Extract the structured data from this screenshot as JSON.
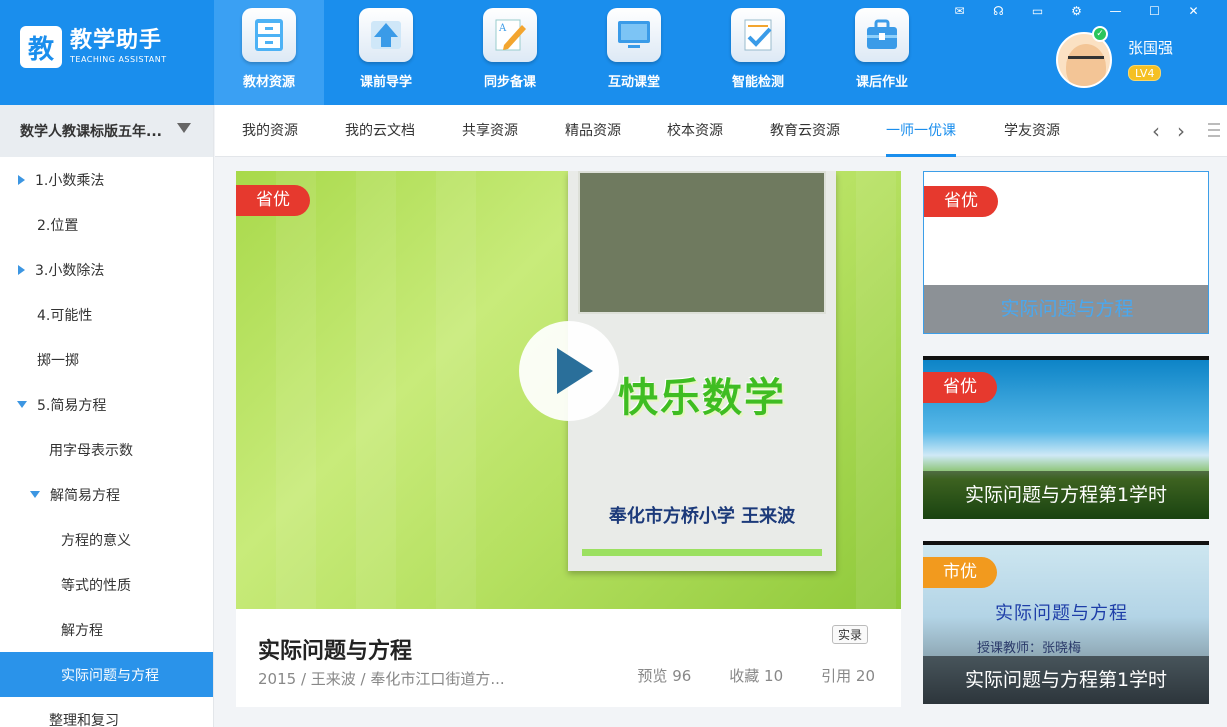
{
  "app": {
    "logo_glyph": "教",
    "name_cn": "教学助手",
    "name_en": "TEACHING ASSISTANT"
  },
  "nav": [
    {
      "label": "教材资源",
      "icon": "cabinet-icon"
    },
    {
      "label": "课前导学",
      "icon": "upload-arrow-icon"
    },
    {
      "label": "同步备课",
      "icon": "pen-paper-icon"
    },
    {
      "label": "互动课堂",
      "icon": "monitor-icon"
    },
    {
      "label": "智能检测",
      "icon": "checklist-icon"
    },
    {
      "label": "课后作业",
      "icon": "toolbox-icon"
    }
  ],
  "window_controls": [
    "mail-icon",
    "headset-icon",
    "chat-icon",
    "gear-icon",
    "minimize-icon",
    "maximize-icon",
    "close-icon"
  ],
  "user": {
    "name": "张国强",
    "level": "LV4"
  },
  "sidebar": {
    "header": "数学人教课标版五年...",
    "items": [
      {
        "label": "1.小数乘法",
        "arrow": "right"
      },
      {
        "label": "2.位置",
        "arrow": ""
      },
      {
        "label": "3.小数除法",
        "arrow": "right"
      },
      {
        "label": "4.可能性",
        "arrow": ""
      },
      {
        "label": "掷一掷",
        "arrow": ""
      },
      {
        "label": "5.简易方程",
        "arrow": "down"
      },
      {
        "label": "用字母表示数",
        "arrow": ""
      },
      {
        "label": "解简易方程",
        "arrow": "down"
      },
      {
        "label": "方程的意义",
        "arrow": ""
      },
      {
        "label": "等式的性质",
        "arrow": ""
      },
      {
        "label": "解方程",
        "arrow": ""
      },
      {
        "label": "实际问题与方程",
        "arrow": ""
      },
      {
        "label": "整理和复习",
        "arrow": ""
      }
    ]
  },
  "tabs": [
    "我的资源",
    "我的云文档",
    "共享资源",
    "精品资源",
    "校本资源",
    "教育云资源",
    "一师一优课",
    "学友资源"
  ],
  "active_tab": "一师一优课",
  "main_video": {
    "tag": "省优",
    "slide_title": "快乐数学",
    "slide_author": "奉化市方桥小学 王来波",
    "title": "实际问题与方程",
    "badge": "实录",
    "meta": "2015 / 王来波 / 奉化市江口街道方...",
    "stats": {
      "preview": "预览 96",
      "favorite": "收藏 10",
      "cite": "引用 20"
    }
  },
  "side_videos": [
    {
      "tag": "省优",
      "caption": "实际问题与方程"
    },
    {
      "tag": "省优",
      "caption": "实际问题与方程第1学时"
    },
    {
      "tag": "市优",
      "caption": "实际问题与方程第1学时",
      "slide_title": "实际问题与方程",
      "teacher": "授课教师：张晓梅"
    }
  ],
  "colors": {
    "brand": "#1a8eed",
    "tag_red": "#e6392e",
    "tag_orange": "#f29a1e",
    "selected": "#2a93ea"
  }
}
